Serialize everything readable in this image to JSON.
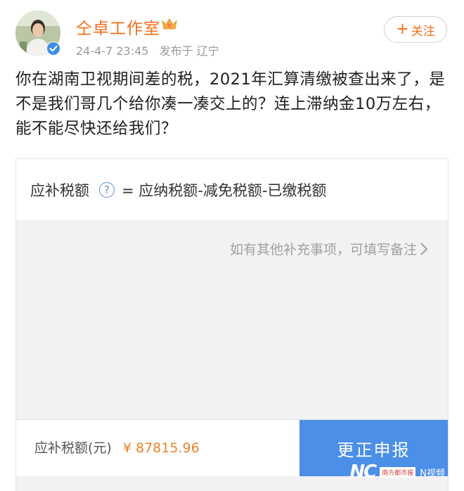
{
  "post": {
    "username": "仝卓工作室",
    "timestamp": "24-4-7 23:45",
    "source": "发布于 辽宁",
    "follow_label": "关注",
    "text": "你在湖南卫视期间差的税，2021年汇算清缴被查出来了，是不是我们哥几个给你凑一凑交上的？连上滞纳金10万左右，能不能尽快还给我们？"
  },
  "screenshot": {
    "formula_label": "应补税额",
    "help_glyph": "?",
    "formula": "= 应纳税额-减免税额-已缴税额",
    "remark_placeholder": "如有其他补充事项，可填写备注",
    "amount_label": "应补税额(元)",
    "amount_value": "¥ 87815.96",
    "submit_label": "更正申报"
  },
  "watermark": {
    "logo_text": "NC",
    "brand": "南方都市报",
    "video": "N视频"
  },
  "colors": {
    "accent_orange": "#f56c1a",
    "submit_blue": "#4b8fe8",
    "amount_orange": "#e8842a",
    "verified_blue": "#3b8fe6"
  },
  "icons": [
    "avatar",
    "verified-icon",
    "crown-icon",
    "plus-icon",
    "help-icon",
    "chevron-right-icon"
  ]
}
